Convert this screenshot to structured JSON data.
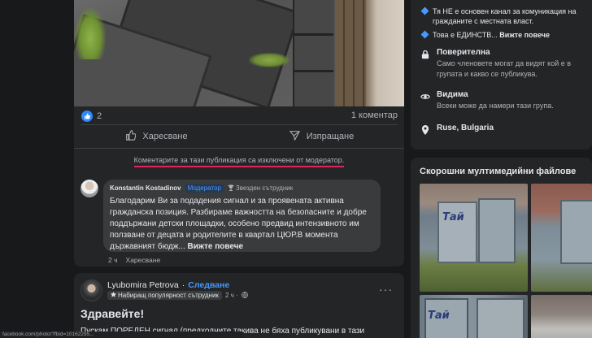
{
  "post1": {
    "reaction_count": "2",
    "comments_count": "1 коментар",
    "like_label": "Харесване",
    "share_label": "Изпращане",
    "comments_disabled": "Коментарите за тази публикация са изключени от модератор.",
    "comment": {
      "author": "Konstantin Kostadinov",
      "role_badge": "Модератор",
      "star_badge": "Звезден сътрудник",
      "text": "Благодарим Ви за подадения сигнал и за проявената активна гражданска позиция. Разбираме важността на безопасните и добре поддържани детски площадки, особено предвид интензивното им ползване от децата и родителите в квартал ЦЮР.В момента държавният бюдж...",
      "see_more": "Вижте повече",
      "time": "2 ч",
      "like": "Харесване"
    }
  },
  "post2": {
    "author": "Lyubomira Petrova",
    "separator": "·",
    "follow": "Следване",
    "badge": "Набиращ популярност сътрудник",
    "time": "2 ч ·",
    "dots": "···",
    "title": "Здравейте!",
    "body": "Пускам ПОРЕДЕН сигнал (предходните такива не бяха публикувани в тази"
  },
  "url_bar": "facebook.com/photo/?fbid=10162295...",
  "about": {
    "bullet1": "Тя НЕ е основен канал за комуникация на гражданите с местната власт.",
    "bullet2_text": "Това е ЕДИНСТВ...",
    "bullet2_more": "Вижте повече",
    "private_title": "Поверителна",
    "private_desc": "Само членовете могат да видят кой е в групата и какво се публикува.",
    "visible_title": "Видима",
    "visible_desc": "Всеки може да намери тази група.",
    "location": "Ruse, Bulgaria"
  },
  "media": {
    "title": "Скорошни мултимедийни файлове",
    "graffiti1": "Тай",
    "graffiti2": "Тай"
  },
  "colors": {
    "accent": "#4599ff",
    "background": "#18191a",
    "card": "#242526",
    "moderator_underline": "#e0245e"
  }
}
